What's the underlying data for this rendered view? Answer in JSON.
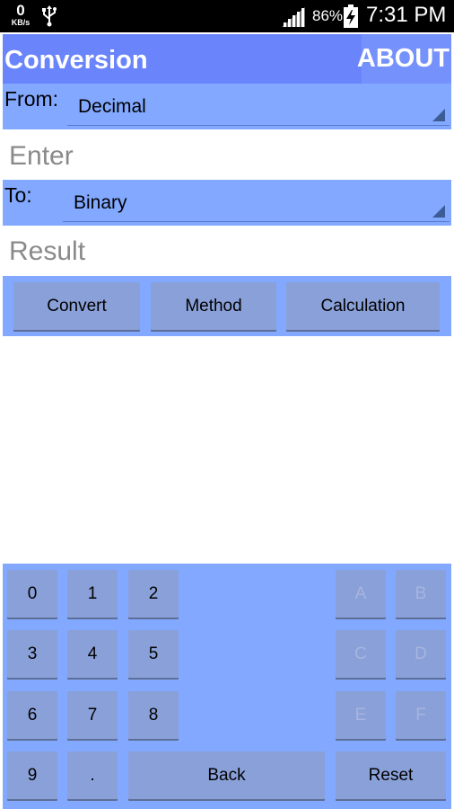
{
  "status_bar": {
    "net_speed_value": "0",
    "net_speed_unit": "KB/s",
    "battery_percent": "86%",
    "time": "7:31 PM"
  },
  "header": {
    "title": "Conversion",
    "about_label": "ABOUT"
  },
  "from": {
    "label": "From:",
    "selected": "Decimal"
  },
  "input": {
    "placeholder": "Enter"
  },
  "to": {
    "label": "To:",
    "selected": "Binary"
  },
  "result": {
    "placeholder": "Result"
  },
  "actions": {
    "convert": "Convert",
    "method": "Method",
    "calculation": "Calculation"
  },
  "keypad": {
    "k0": "0",
    "k1": "1",
    "k2": "2",
    "k3": "3",
    "k4": "4",
    "k5": "5",
    "k6": "6",
    "k7": "7",
    "k8": "8",
    "k9": "9",
    "dot": ".",
    "back": "Back",
    "reset": "Reset",
    "kA": "A",
    "kB": "B",
    "kC": "C",
    "kD": "D",
    "kE": "E",
    "kF": "F"
  },
  "colors": {
    "title_bar": "#6a85fb",
    "panel": "#82a8ff",
    "button": "#8aa0d8",
    "disabled_text": "#a7b5de"
  }
}
